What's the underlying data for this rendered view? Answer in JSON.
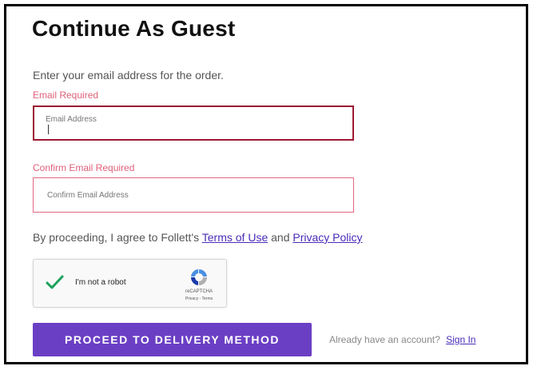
{
  "title": "Continue As Guest",
  "intro": "Enter your email address for the order.",
  "email": {
    "error": "Email Required",
    "placeholder": "Email Address",
    "value": ""
  },
  "confirm_email": {
    "error": "Confirm Email Required",
    "placeholder": "Confirm Email Address",
    "value": ""
  },
  "agreement": {
    "prefix": "By proceeding, I agree to Follett's",
    "terms_link": "Terms of Use",
    "middle": "and",
    "privacy_link": "Privacy Policy"
  },
  "captcha": {
    "label": "I'm not a robot",
    "brand": "reCAPTCHA",
    "links": "Privacy - Terms",
    "icon": "check-icon",
    "checked": true
  },
  "proceed_button": "PROCEED TO DELIVERY METHOD",
  "account": {
    "prompt": "Already have an account?",
    "signin": "Sign In"
  },
  "colors": {
    "accent": "#6b3fc4",
    "link": "#4a2bb8",
    "error": "#e0607a",
    "error_border_focused": "#9b1a32",
    "check": "#1aa15a"
  }
}
